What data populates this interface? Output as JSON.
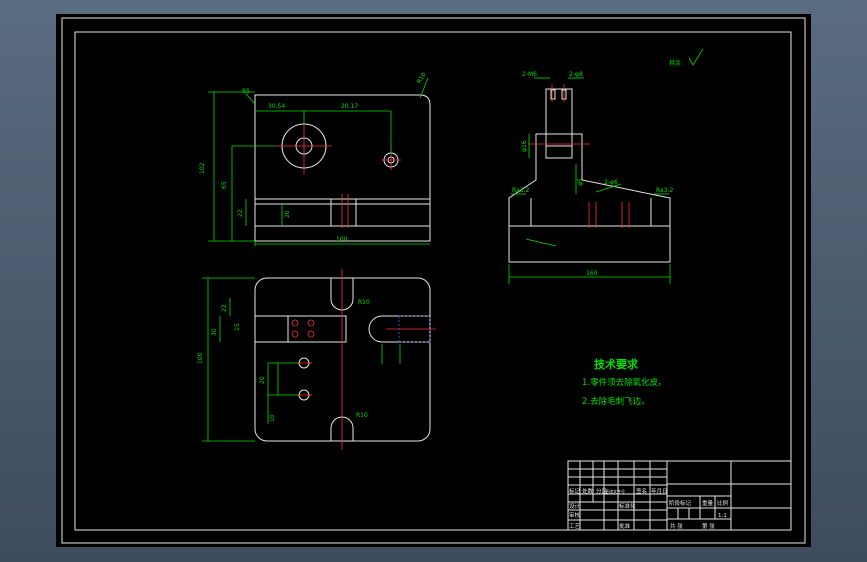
{
  "drawing": {
    "roughness_mark": "其余",
    "notes_title": "技术要求",
    "notes": [
      "1.零件须去除氧化皮。",
      "2.去除毛刺飞边。"
    ]
  },
  "dims": {
    "front_tl": "R5",
    "front_tr": "R10",
    "front_w1": "30.54",
    "front_w2": "20.17",
    "front_h_total": "102",
    "front_h_mid": "65",
    "front_h_low": "22",
    "front_slot": "20",
    "front_width": "100",
    "top_d1": "30",
    "top_d2": "22",
    "top_d3": "15",
    "top_h": "100",
    "top_b1": "20",
    "top_b2": "10",
    "top_r1": "R10",
    "top_r2": "R10",
    "side_t1": "2-M6",
    "side_t2": "2-φ8",
    "side_r1": "Ra3.2",
    "side_r2": "Ra3.2",
    "side_d": "φ16",
    "side_h": "φ5",
    "side_w": "160",
    "side_c": "2-φ6"
  },
  "title_block": {
    "row1": [
      "标记",
      "处数",
      "分区",
      "更改文件号",
      "签名",
      "年月日"
    ],
    "row2": [
      "设计",
      "",
      "标准化",
      "",
      "阶段标记",
      "重量",
      "比例"
    ],
    "row3": [
      "审核",
      "",
      "",
      "",
      "",
      "",
      "1:1"
    ],
    "row4": [
      "工艺",
      "",
      "批准",
      "",
      "共 张",
      "第 张"
    ]
  },
  "colors": {
    "outline": "#e6e6e6",
    "dimension": "#00e000",
    "centerline": "#ff3030",
    "hatch": "#3a68c8"
  }
}
